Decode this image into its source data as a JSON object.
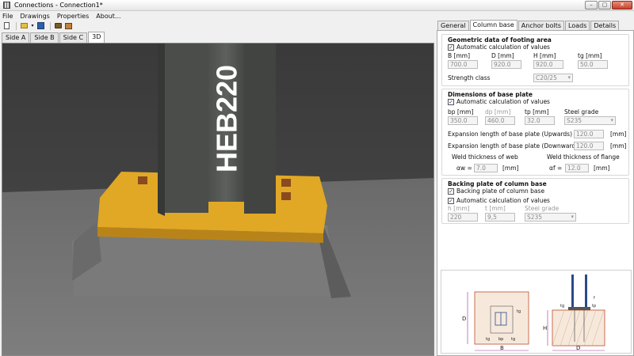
{
  "window": {
    "title": "Connections - Connection1*",
    "minimize": "–",
    "maximize": "▢",
    "close": "✕"
  },
  "menu": [
    "File",
    "Drawings",
    "Properties",
    "About..."
  ],
  "toolbar": {
    "new": "new-file-icon",
    "open": "open-folder-icon",
    "save": "save-icon",
    "screenshot": "camera-icon",
    "export": "image-export-icon"
  },
  "view_tabs": [
    "Side A",
    "Side B",
    "Side C",
    "3D"
  ],
  "viewport": {
    "profile_label": "HEB220"
  },
  "prop_tabs": [
    "General",
    "Column base",
    "Anchor bolts",
    "Loads",
    "Details"
  ],
  "footing": {
    "title": "Geometric data of footing area",
    "auto_label": "Automatic calculation of values",
    "b_label": "B [mm]",
    "b_value": "700.0",
    "d_label": "D [mm]",
    "d_value": "920.0",
    "h_label": "H [mm]",
    "h_value": "920.0",
    "tg_label": "tg [mm]",
    "tg_value": "50.0",
    "strength_label": "Strength class",
    "strength_value": "C20/25"
  },
  "base_plate": {
    "title": "Dimensions of base plate",
    "auto_label": "Automatic calculation of values",
    "bp_label": "bp [mm]",
    "bp_value": "350.0",
    "dp_label": "dp [mm]",
    "dp_value": "460.0",
    "tp_label": "tp [mm]",
    "tp_value": "32.0",
    "grade_label": "Steel grade",
    "grade_value": "S235",
    "exp_up_label": "Expansion length of base plate (Upwards)",
    "exp_up_value": "120.0",
    "exp_up_unit": "[mm]",
    "exp_down_label": "Expansion length of base plate (Downwards)",
    "exp_down_value": "120.0",
    "exp_down_unit": "[mm]",
    "weld_web_label": "Weld thickness of web",
    "weld_web_sym": "αw =",
    "weld_web_value": "7.0",
    "weld_web_unit": "[mm]",
    "weld_flange_label": "Weld thickness of flange",
    "weld_flange_sym": "αf =",
    "weld_flange_value": "12.0",
    "weld_flange_unit": "[mm]"
  },
  "backing": {
    "title": "Backing plate of column base",
    "enable_label": "Backing plate of column base",
    "auto_label": "Automatic calculation of values",
    "h_label": "h [mm]",
    "h_value": "220",
    "t_label": "t [mm]",
    "t_value": "9,5",
    "grade_label": "Steel grade",
    "grade_value": "S235"
  },
  "diagram": {
    "d": "D",
    "b": "B",
    "tg": "tg",
    "bp": "bp",
    "h": "H",
    "tp": "tp",
    "f": "f"
  }
}
